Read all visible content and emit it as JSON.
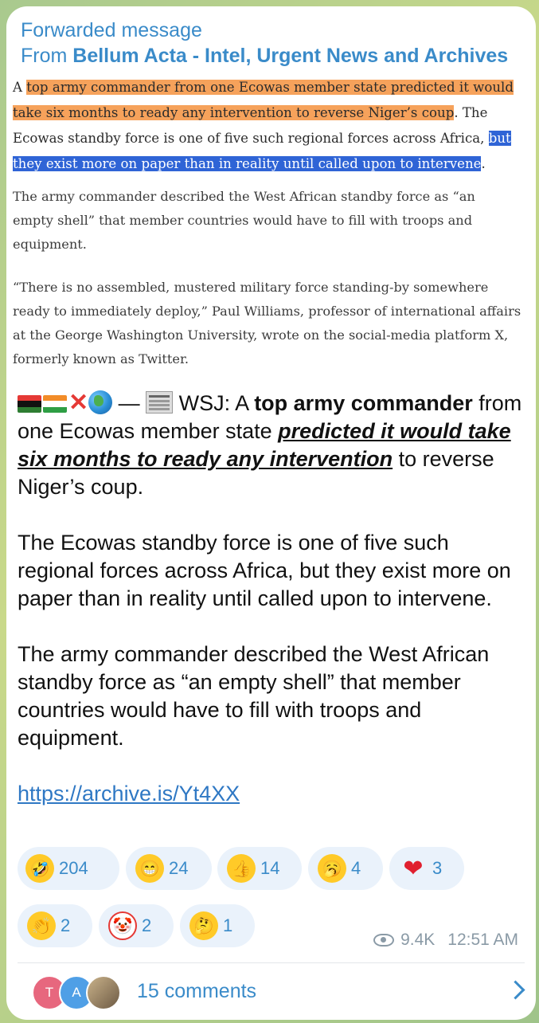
{
  "forward": {
    "label": "Forwarded message",
    "from_prefix": "From ",
    "source": "Bellum Acta - Intel, Urgent News and Archives"
  },
  "screenshot_text": {
    "p1_a": "A ",
    "p1_hl1": "top army commander from one Ecowas member state predicted it would take six months to ready any intervention to reverse Niger’s coup",
    "p1_b": ". The Ecowas standby force is one of five such regional forces across Africa, ",
    "p1_hl2": "but they exist more on paper than in reality until called upon to intervene",
    "p1_c": ".",
    "p2": "The army commander described the West African standby force as “an empty shell” that member countries would have to fill with troops and equipment.",
    "p3": "“There is no assembled, mustered military force standing-by somewhere ready to immediately deploy,” Paul Williams, professor of international affairs at the George Washington University, wrote on the social-media platform X, formerly known as Twitter."
  },
  "message": {
    "dash": " — ",
    "p1_a": " WSJ: A ",
    "p1_bold": "top army commander",
    "p1_b": " from one Ecowas member state ",
    "p1_ui": "predicted it would take six months to ready any intervention",
    "p1_c": " to reverse Niger’s coup.",
    "p2": "The Ecowas standby force is one of five such regional forces across Africa, but they exist more on paper than in reality until called upon to intervene.",
    "p3": "The army commander described the West African standby force as “an empty shell” that member countries would have to fill with troops and equipment.",
    "link": "https://archive.is/Yt4XX",
    "emoji_icons": [
      "flag-icon",
      "niger-flag-icon",
      "cross-mark-icon",
      "globe-icon",
      "newspaper-icon"
    ]
  },
  "reactions": [
    {
      "icon": "rolling-laughing-icon",
      "glyph": "🤣",
      "count": "204"
    },
    {
      "icon": "grinning-face-icon",
      "glyph": "😁",
      "count": "24"
    },
    {
      "icon": "thumbs-up-icon",
      "glyph": "👍",
      "count": "14"
    },
    {
      "icon": "yawning-face-icon",
      "glyph": "🥱",
      "count": "4"
    },
    {
      "icon": "heart-icon",
      "glyph": "❤",
      "count": "3"
    },
    {
      "icon": "clapping-hands-icon",
      "glyph": "👏",
      "count": "2"
    },
    {
      "icon": "clown-face-icon",
      "glyph": "🤡",
      "count": "2"
    },
    {
      "icon": "thinking-face-icon",
      "glyph": "🤔",
      "count": "1"
    }
  ],
  "meta": {
    "views": "9.4K",
    "time": "12:51 AM"
  },
  "comments": {
    "avatars": [
      {
        "initial": "T",
        "color": "#e7677e"
      },
      {
        "initial": "A",
        "color": "#4f9fe6"
      }
    ],
    "label": "15 comments"
  }
}
